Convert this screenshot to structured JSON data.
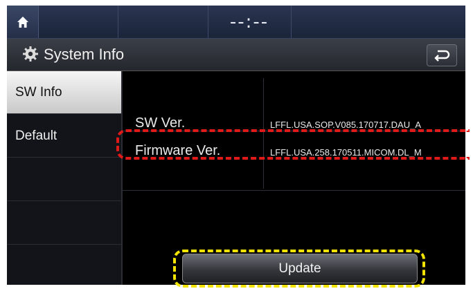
{
  "status_bar": {
    "clock": "--:--"
  },
  "title_bar": {
    "title": "System Info"
  },
  "sidebar": {
    "items": [
      {
        "label": "SW Info",
        "active": true
      },
      {
        "label": "Default",
        "active": false
      }
    ]
  },
  "info": {
    "rows": [
      {
        "label": "SW Ver.",
        "value": "LFFL.USA.SOP.V085.170717.DAU_A"
      },
      {
        "label": "Firmware Ver.",
        "value": "LFFL.USA.258.170511.MICOM.DL_M"
      }
    ]
  },
  "update_button": {
    "label": "Update"
  },
  "icons": {
    "home": "home-icon",
    "settings": "gear-icon",
    "back": "back-arrow-icon"
  },
  "colors": {
    "highlight_red": "#e01919",
    "highlight_yellow": "#f2e400"
  }
}
